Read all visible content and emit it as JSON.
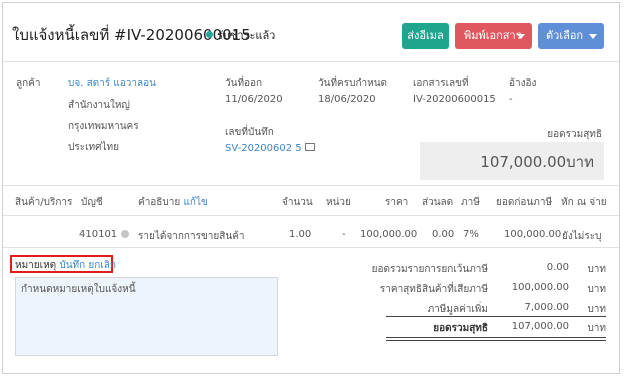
{
  "header": {
    "title": "ใบแจ้งหนี้เลขที่ #IV-20200600015",
    "status": "รับชำระแล้ว",
    "status_color": "#26a69a",
    "buttons": {
      "email": "ส่งอีเมล",
      "print": "พิมพ์เอกสาร",
      "options": "ตัวเลือก"
    }
  },
  "customer": {
    "label": "ลูกค้า",
    "name": "บจ. สตาร์ แอวาลอน",
    "branch": "สำนักงานใหญ่",
    "city": "กรุงเทพมหานคร",
    "country": "ประเทศไทย"
  },
  "meta": {
    "issue_date_label": "วันที่ออก",
    "issue_date": "11/06/2020",
    "due_date_label": "วันที่ครบกำหนด",
    "due_date": "18/06/2020",
    "doc_no_label": "เอกสารเลขที่",
    "doc_no": "IV-20200600015",
    "reference_label": "อ้างอิง",
    "reference": "-",
    "record_no_label": "เลขที่บันทึก",
    "record_no": "SV-20200602 5"
  },
  "grand_total": {
    "label": "ยอดรวมสุทธิ",
    "amount": "107,000.00บาท"
  },
  "table": {
    "headers": {
      "item": "สินค้า/บริการ",
      "account": "บัญชี",
      "description": "คำอธิบาย",
      "description_edit": "แก้ไข",
      "qty": "จำนวน",
      "unit": "หน่วย",
      "price": "ราคา",
      "discount": "ส่วนลด",
      "vat": "ภาษี",
      "pretax": "ยอดก่อนภาษี",
      "wht": "หัก ณ จ่าย"
    },
    "rows": [
      {
        "account": "410101",
        "description": "รายได้จากการขายสินค้า",
        "qty": "1.00",
        "unit": "-",
        "price": "100,000.00",
        "discount": "0.00",
        "vat": "7%",
        "pretax": "100,000.00",
        "wht": "ยังไม่ระบุ"
      }
    ]
  },
  "notes": {
    "label": "หมายเหตุ",
    "save": "บันทึก",
    "cancel": "ยกเลิก",
    "placeholder": "กำหนดหมายเหตุใบแจ้งหนี้"
  },
  "summary": [
    {
      "label": "ยอดรวมรายการยกเว้นภาษี",
      "value": "0.00",
      "unit": "บาท"
    },
    {
      "label": "ราคาสุทธิสินค้าที่เสียภาษี",
      "value": "100,000.00",
      "unit": "บาท"
    },
    {
      "label": "ภาษีมูลค่าเพิ่ม",
      "value": "7,000.00",
      "unit": "บาท"
    },
    {
      "label": "ยอดรวมสุทธิ",
      "value": "107,000.00",
      "unit": "บาท"
    }
  ]
}
